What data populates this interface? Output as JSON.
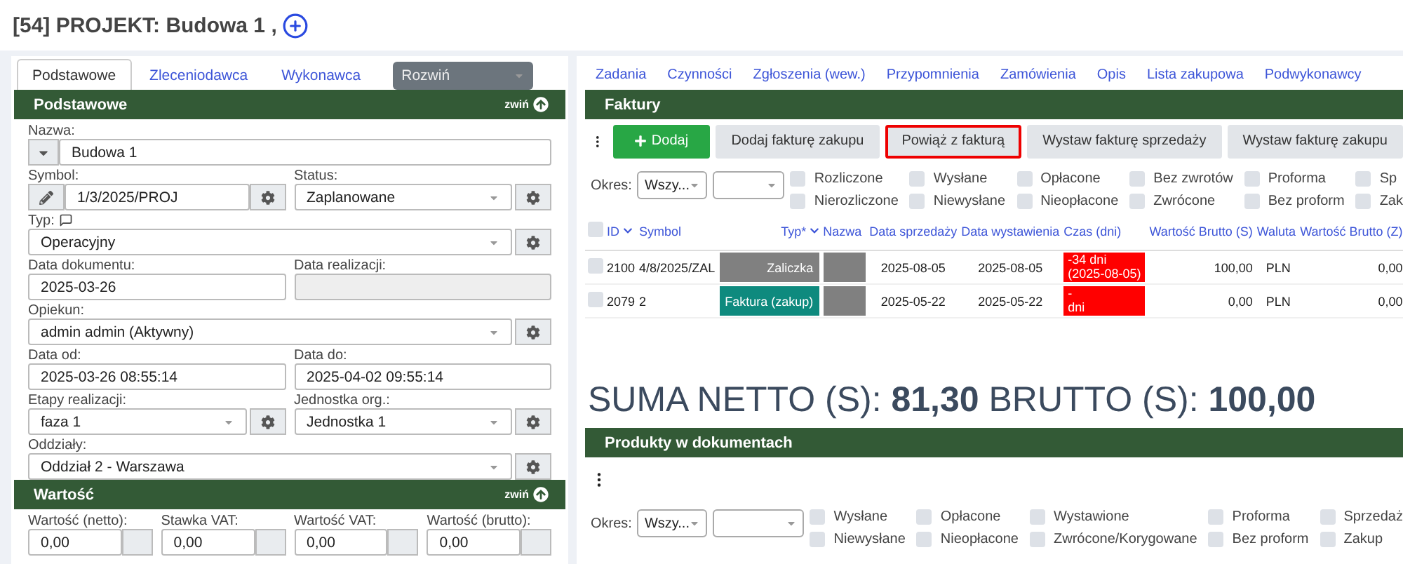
{
  "title": "[54] PROJEKT: Budowa 1 ,",
  "left": {
    "tabs": [
      {
        "label": "Podstawowe",
        "selected": true
      },
      {
        "label": "Zleceniodawca",
        "selected": false
      },
      {
        "label": "Wykonawca",
        "selected": false
      }
    ],
    "expand": "Rozwiń",
    "sections": [
      {
        "title": "Podstawowe",
        "collapse": "zwiń",
        "rows": [
          [
            {
              "label": "Nazwa:",
              "value": "Budowa 1",
              "kind": "name",
              "settings": false
            }
          ],
          [
            {
              "label": "Symbol:",
              "value": "1/3/2025/PROJ",
              "kind": "symbol",
              "settings": true
            },
            {
              "label": "Status:",
              "value": "Zaplanowane",
              "kind": "select",
              "settings": true
            }
          ],
          [
            {
              "label": "Typ:",
              "value": "Operacyjny",
              "kind": "select",
              "settings": true,
              "note": true
            }
          ],
          [
            {
              "label": "Data dokumentu:",
              "value": "2025-03-26",
              "kind": "text",
              "settings": false
            },
            {
              "label": "Data realizacji:",
              "kind": "disabled",
              "settings": false
            }
          ],
          [
            {
              "label": "Opiekun:",
              "value": "admin admin (Aktywny)",
              "kind": "select",
              "settings": true
            }
          ],
          [
            {
              "label": "Data od:",
              "value": "2025-03-26 08:55:14",
              "kind": "text",
              "settings": false
            },
            {
              "label": "Data do:",
              "value": "2025-04-02 09:55:14",
              "kind": "text",
              "settings": false
            }
          ],
          [
            {
              "label": "Etapy realizacji:",
              "value": "faza 1",
              "kind": "select",
              "settings": true
            },
            {
              "label": "Jednostka org.:",
              "value": "Jednostka 1",
              "kind": "select",
              "settings": true
            }
          ],
          [
            {
              "label": "Oddziały:",
              "value": "Oddział 2 - Warszawa",
              "kind": "select",
              "settings": true
            }
          ]
        ]
      },
      {
        "title": "Wartość",
        "collapse": "zwiń",
        "rows": [
          [
            {
              "label": "Wartość (netto):",
              "value": "0,00",
              "kind": "amount",
              "settings": false
            },
            {
              "label": "Stawka VAT:",
              "value": "0,00",
              "kind": "amount",
              "settings": false
            },
            {
              "label": "Wartość VAT:",
              "value": "0,00",
              "kind": "amount",
              "settings": false
            },
            {
              "label": "Wartość (brutto):",
              "value": "0,00",
              "kind": "amount",
              "settings": false
            }
          ]
        ]
      }
    ]
  },
  "right": {
    "tabs": [
      "Zadania",
      "Czynności",
      "Zgłoszenia (wew.)",
      "Przypomnienia",
      "Zamówienia",
      "Opis",
      "Lista zakupowa",
      "Podwykonawcy"
    ],
    "invoices": {
      "title": "Faktury",
      "buttons": [
        {
          "label": "Dodaj",
          "kind": "primary"
        },
        {
          "label": "Dodaj fakturę zakupu",
          "kind": "secondary"
        },
        {
          "label": "Powiąż z fakturą",
          "kind": "highlighted"
        },
        {
          "label": "Wystaw fakturę sprzedaży",
          "kind": "secondary"
        },
        {
          "label": "Wystaw fakturę zakupu",
          "kind": "secondary"
        }
      ],
      "period_label": "Okres:",
      "period": "Wszy...",
      "filters": [
        {
          "label": "Rozliczone",
          "checked": false
        },
        {
          "label": "Nierozliczone",
          "checked": false
        },
        {
          "label": "Wysłane",
          "checked": false
        },
        {
          "label": "Niewysłane",
          "checked": false
        },
        {
          "label": "Opłacone",
          "checked": false
        },
        {
          "label": "Nieopłacone",
          "checked": false
        },
        {
          "label": "Bez zwrotów",
          "checked": false
        },
        {
          "label": "Zwrócone",
          "checked": false
        },
        {
          "label": "Proforma",
          "checked": false
        },
        {
          "label": "Bez proform",
          "checked": false
        },
        {
          "label": "Sp",
          "checked": false
        },
        {
          "label": "Zak",
          "checked": false
        }
      ],
      "table": {
        "header_checked": false,
        "columns": [
          {
            "label": "ID",
            "sortable": true
          },
          {
            "label": "Symbol",
            "sortable": false
          },
          {
            "label": "Typ*",
            "sortable": true
          },
          {
            "label": "Nazwa",
            "sortable": false
          },
          {
            "label": "Data sprzedaży",
            "sortable": false
          },
          {
            "label": "Data wystawienia",
            "sortable": false
          },
          {
            "label": "Czas (dni)",
            "sortable": false
          },
          {
            "label": "Wartość Brutto (S)",
            "sortable": false
          },
          {
            "label": "Waluta",
            "sortable": false
          },
          {
            "label": "Wartość Brutto (Z)",
            "sortable": false
          }
        ],
        "rows": [
          {
            "checked": false,
            "id": "2100",
            "symbol": "4/8/2025/ZAL",
            "type": "Zaliczka",
            "color": "#808080",
            "sale_date": "2025-08-05",
            "issue_date": "2025-08-05",
            "time": [
              "-34 dni",
              "(2025-08-05)"
            ],
            "gross_s": "100,00",
            "currency": "PLN",
            "gross_z": "0,00"
          },
          {
            "checked": false,
            "id": "2079",
            "symbol": "2",
            "type": "Faktura (zakup)",
            "color": "#0e8a7e",
            "sale_date": "2025-05-22",
            "issue_date": "2025-05-22",
            "time": [
              "-",
              "dni"
            ],
            "gross_s": "0,00",
            "currency": "PLN",
            "gross_z": "0,00"
          }
        ]
      }
    },
    "summary": "SUMA NETTO (S): **81,30** BRUTTO (S): **100,00**",
    "products": {
      "title": "Produkty w dokumentach",
      "period_label": "Okres:",
      "period": "Wszy...",
      "filters": [
        {
          "label": "Wysłane",
          "checked": false
        },
        {
          "label": "Niewysłane",
          "checked": false
        },
        {
          "label": "Opłacone",
          "checked": false
        },
        {
          "label": "Nieopłacone",
          "checked": false
        },
        {
          "label": "Wystawione",
          "checked": false
        },
        {
          "label": "Zwrócone/Korygowane",
          "checked": false
        },
        {
          "label": "Proforma",
          "checked": false
        },
        {
          "label": "Bez proform",
          "checked": false
        },
        {
          "label": "Sprzedaż",
          "checked": false
        },
        {
          "label": "Zakup",
          "checked": false
        }
      ]
    }
  }
}
